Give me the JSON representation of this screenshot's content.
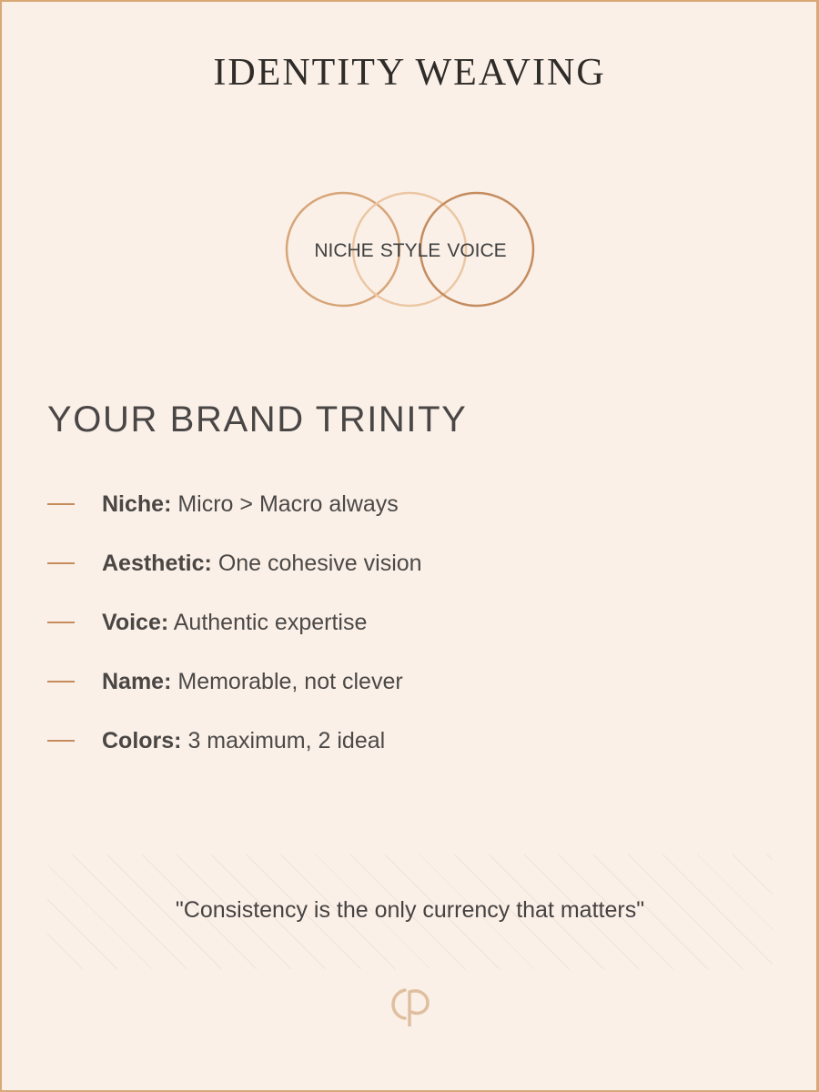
{
  "header": {
    "title": "IDENTITY WEAVING"
  },
  "venn": {
    "circles": [
      {
        "label": "NICHE",
        "color": "#d7a578"
      },
      {
        "label": "STYLE",
        "color": "#ebc7a3"
      },
      {
        "label": "VOICE",
        "color": "#c48c5f"
      }
    ]
  },
  "trinity": {
    "heading": "YOUR BRAND TRINITY",
    "items": [
      {
        "label": "Niche:",
        "text": " Micro > Macro always"
      },
      {
        "label": "Aesthetic:",
        "text": " One cohesive vision"
      },
      {
        "label": "Voice:",
        "text": " Authentic expertise"
      },
      {
        "label": "Name:",
        "text": " Memorable, not clever"
      },
      {
        "label": "Colors:",
        "text": " 3 maximum, 2 ideal"
      }
    ]
  },
  "quote": {
    "text": "\"Consistency is the only currency that matters\""
  },
  "logo": {
    "icon": "monogram-logo",
    "color": "#dfbf9f"
  },
  "colors": {
    "background": "#faf0e8",
    "border": "#d8a877",
    "accent": "#c58c5c"
  }
}
